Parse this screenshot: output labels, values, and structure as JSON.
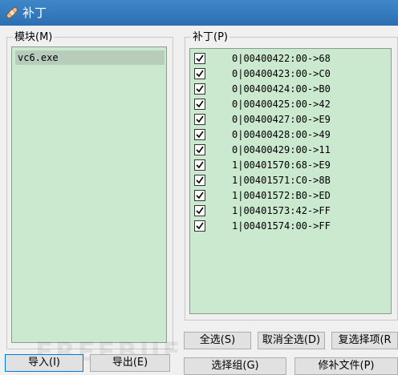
{
  "window": {
    "title": "补丁"
  },
  "modules": {
    "label": "模块(M)",
    "items": [
      "vc6.exe"
    ]
  },
  "patches": {
    "label": "补丁(P)",
    "items": [
      {
        "text": "0|00400422:00->68",
        "checked": true
      },
      {
        "text": "0|00400423:00->C0",
        "checked": true
      },
      {
        "text": "0|00400424:00->B0",
        "checked": true
      },
      {
        "text": "0|00400425:00->42",
        "checked": true
      },
      {
        "text": "0|00400427:00->E9",
        "checked": true
      },
      {
        "text": "0|00400428:00->49",
        "checked": true
      },
      {
        "text": "0|00400429:00->11",
        "checked": true
      },
      {
        "text": "1|00401570:68->E9",
        "checked": true
      },
      {
        "text": "1|00401571:C0->8B",
        "checked": true
      },
      {
        "text": "1|00401572:B0->ED",
        "checked": true
      },
      {
        "text": "1|00401573:42->FF",
        "checked": true
      },
      {
        "text": "1|00401574:00->FF",
        "checked": true
      }
    ]
  },
  "buttons": {
    "import": "导入(I)",
    "export": "导出(E)",
    "select_all": "全选(S)",
    "deselect_all": "取消全选(D)",
    "restore_selected": "复选择项(R",
    "select_group": "选择组(G)",
    "patch_file": "修补文件(P)"
  },
  "watermark": "FREEBUF",
  "colors": {
    "list_bg": "#cbe9cf",
    "selected_bg": "#b8ccbb",
    "titlebar": "#2b6fb2"
  }
}
